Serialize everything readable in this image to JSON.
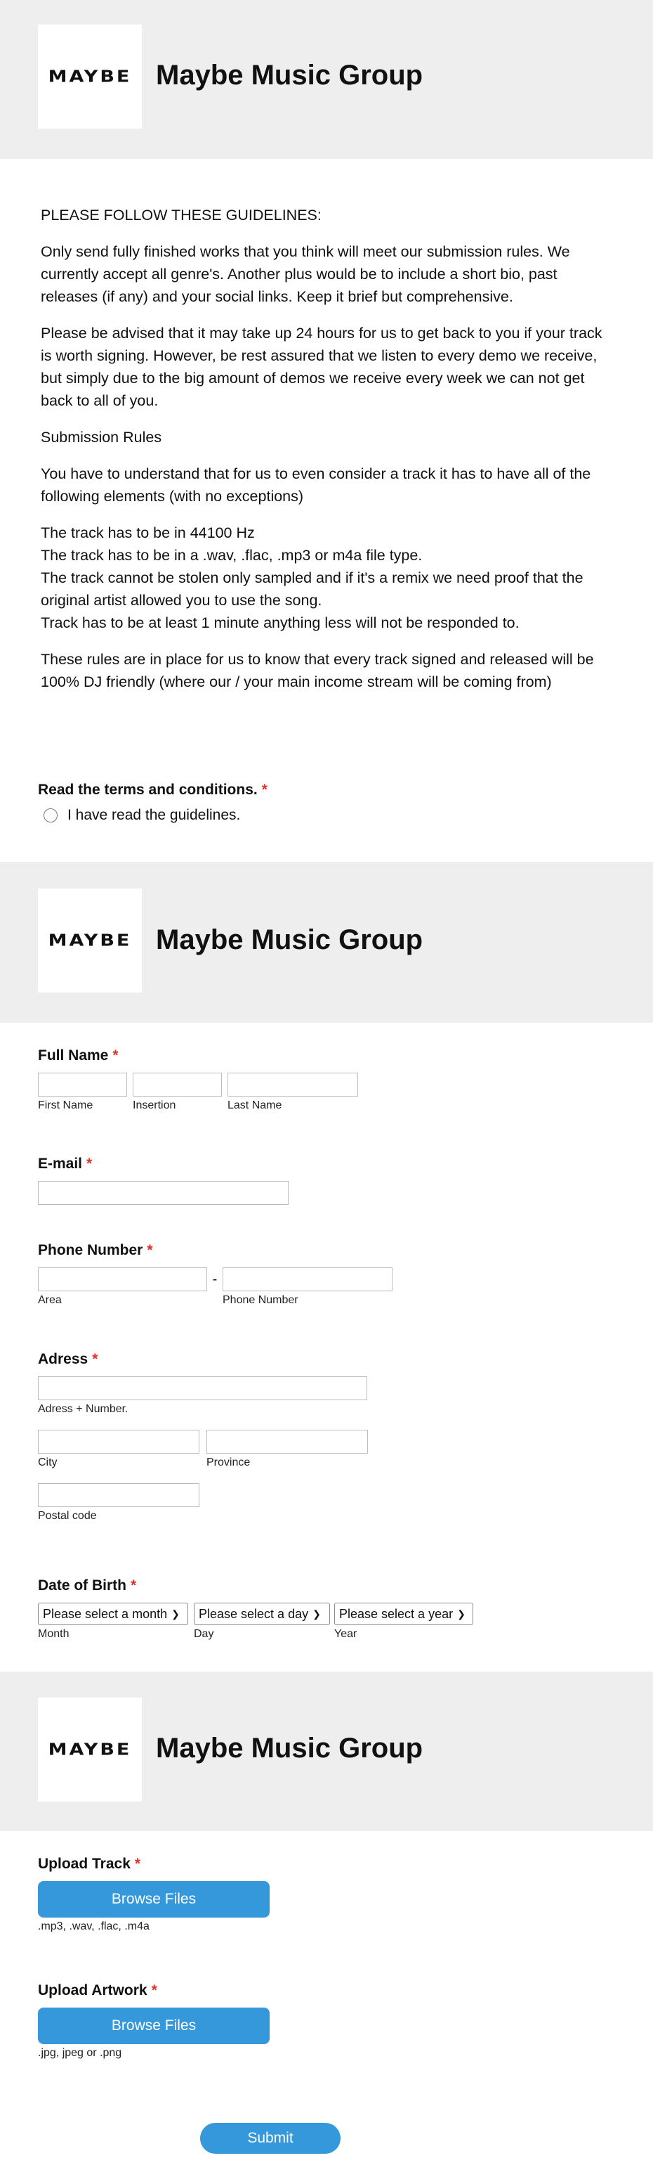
{
  "brand": {
    "logo": "MAYBE",
    "title": "Maybe Music Group"
  },
  "guidelines": {
    "heading": "PLEASE FOLLOW THESE GUIDELINES:",
    "p1": "Only send fully finished works that you think will meet our submission rules. We currently accept all genre's. Another plus would be to include a short bio, past releases (if any) and your social links. Keep it brief but comprehensive.",
    "p2": "Please be advised that it may take up 24 hours for us to get back to you if your track is worth signing. However, be rest assured that we listen to every demo we receive, but simply due to the big amount of demos we receive every week we can not get back to all of you.",
    "rules_title": "Submission Rules",
    "p3": "You have to understand that for us to even consider a track it has to have all of the following elements (with no exceptions)",
    "rules": [
      "The track has to be in 44100 Hz",
      "The track has to be in a .wav, .flac, .mp3 or m4a file type.",
      "The track cannot be stolen only sampled and if it's a remix we need proof that the original artist allowed you to use the song.",
      "Track has to be at least 1 minute anything less will not be responded to."
    ],
    "p4": "These rules are in place for us to know that every track signed and released will be 100% DJ friendly (where our / your main income stream will be coming from)"
  },
  "terms": {
    "label": "Read the terms and conditions.",
    "required": "*",
    "option": "I have read the guidelines."
  },
  "full_name": {
    "label": "Full Name",
    "required": "*",
    "first": "First Name",
    "insertion": "Insertion",
    "last": "Last Name"
  },
  "email": {
    "label": "E-mail",
    "required": "*"
  },
  "phone": {
    "label": "Phone Number",
    "required": "*",
    "separator": "-",
    "area": "Area",
    "number": "Phone Number"
  },
  "address": {
    "label": "Adress",
    "required": "*",
    "street": "Adress + Number.",
    "city": "City",
    "province": "Province",
    "postal": "Postal code"
  },
  "dob": {
    "label": "Date of Birth",
    "required": "*",
    "month_select": "Please select a month",
    "day_select": "Please select a day",
    "year_select": "Please select a year",
    "month": "Month",
    "day": "Day",
    "year": "Year"
  },
  "upload_track": {
    "label": "Upload Track",
    "required": "*",
    "button": "Browse Files",
    "hint": ".mp3, .wav, .flac, .m4a"
  },
  "upload_artwork": {
    "label": "Upload Artwork",
    "required": "*",
    "button": "Browse Files",
    "hint": ".jpg, jpeg or .png"
  },
  "submit": {
    "label": "Submit"
  },
  "colors": {
    "accent": "#3498db",
    "required": "#e0312b",
    "header_bg": "#eeeeee"
  }
}
